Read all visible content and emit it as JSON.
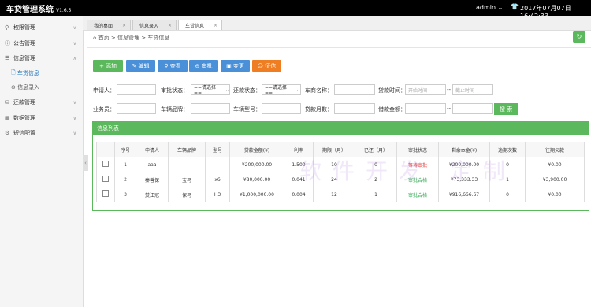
{
  "header": {
    "app_title": "车贷管理系统",
    "version": "V1.6.5",
    "user": "admin",
    "datetime": "2017年07月07日 16:42:33"
  },
  "sidebar": {
    "items": [
      {
        "label": "权限管理"
      },
      {
        "label": "公告管理"
      },
      {
        "label": "信息管理"
      },
      {
        "label": "还款管理"
      },
      {
        "label": "数据管理"
      },
      {
        "label": "短信配置"
      }
    ],
    "subitems": [
      {
        "label": "车贷信息"
      },
      {
        "label": "信息录入"
      }
    ]
  },
  "tabs": [
    {
      "label": "我的桌面"
    },
    {
      "label": "信息录入"
    },
    {
      "label": "车贷信息"
    }
  ],
  "breadcrumb": {
    "home": "首页",
    "sep": ">",
    "level1": "信息管理",
    "level2": "车贷信息"
  },
  "toolbar": {
    "add": "+ 添加",
    "edit": "编辑",
    "view": "查看",
    "approve": "审批",
    "change": "变更",
    "collect": "征信"
  },
  "search": {
    "applicant_label": "申请人：",
    "approval_label": "审批状态：",
    "repay_label": "还款状态：",
    "dealer_label": "车商名称：",
    "loan_time_label": "贷款时间：",
    "salesman_label": "业务员：",
    "brand_label": "车辆品牌：",
    "model_label": "车辆型号：",
    "months_label": "贷款月数：",
    "amount_label": "借款金额：",
    "select_placeholder": "==请选择==",
    "start_placeholder": "开始时间",
    "end_placeholder": "截止时间",
    "range_sep": "--",
    "search_button": "搜 索"
  },
  "panel": {
    "title": "信息列表"
  },
  "table": {
    "headers": [
      "",
      "序号",
      "申请人",
      "车辆品牌",
      "型号",
      "贷款金额(¥)",
      "利率",
      "期限（月）",
      "已还（月）",
      "审批状态",
      "剩余本金(¥)",
      "逾期次数",
      "往期欠款"
    ],
    "rows": [
      {
        "no": "1",
        "applicant": "aaa",
        "brand": "",
        "model": "",
        "amount": "¥200,000.00",
        "rate": "1.500",
        "term": "10",
        "paid": "0",
        "status": "等待审批",
        "remaining": "¥200,000.00",
        "overdue": "0",
        "arrears": "¥0.00"
      },
      {
        "no": "2",
        "applicant": "秦善保",
        "brand": "宝马",
        "model": "x6",
        "amount": "¥80,000.00",
        "rate": "0.041",
        "term": "24",
        "paid": "2",
        "status": "审批合格",
        "remaining": "¥73,333.33",
        "overdue": "1",
        "arrears": "¥3,900.00"
      },
      {
        "no": "3",
        "applicant": "焚江冠",
        "brand": "保马",
        "model": "H3",
        "amount": "¥1,000,000.00",
        "rate": "0.004",
        "term": "12",
        "paid": "1",
        "status": "审批合格",
        "remaining": "¥916,666.67",
        "overdue": "0",
        "arrears": "¥0.00"
      }
    ]
  },
  "colors": {
    "topbar": "#000000",
    "accent_green": "#5cb85c",
    "accent_blue": "#4a90d9",
    "accent_orange": "#ef7d22",
    "status_pending": "#e3342f",
    "status_ok": "#2fa84f"
  },
  "watermark": {
    "text": "软件开发 定制"
  }
}
